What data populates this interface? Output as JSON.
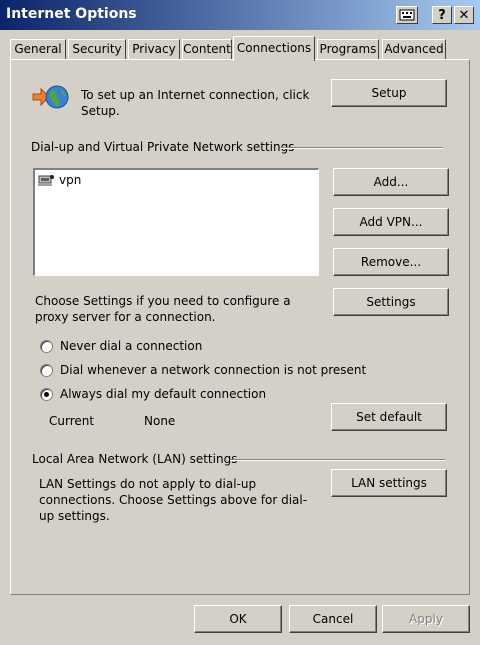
{
  "window": {
    "title": "Internet Options",
    "help_glyph": "?",
    "close_glyph": "✕"
  },
  "tabs": [
    {
      "label": "General"
    },
    {
      "label": "Security"
    },
    {
      "label": "Privacy"
    },
    {
      "label": "Content"
    },
    {
      "label": "Connections"
    },
    {
      "label": "Programs"
    },
    {
      "label": "Advanced"
    }
  ],
  "active_tab": "Connections",
  "setup": {
    "text": "To set up an Internet connection, click Setup.",
    "button": "Setup"
  },
  "dialup": {
    "group_label": "Dial-up and Virtual Private Network settings",
    "connections": [
      {
        "name": "vpn"
      }
    ],
    "add_button": "Add...",
    "add_vpn_button": "Add VPN...",
    "remove_button": "Remove...",
    "proxy_text": "Choose Settings if you need to configure a proxy server for a connection.",
    "settings_button": "Settings",
    "options": [
      {
        "label": "Never dial a connection",
        "selected": false
      },
      {
        "label": "Dial whenever a network connection is not present",
        "selected": false
      },
      {
        "label": "Always dial my default connection",
        "selected": true
      }
    ],
    "current_label": "Current",
    "current_value": "None",
    "set_default_button": "Set default"
  },
  "lan": {
    "group_label": "Local Area Network (LAN) settings",
    "text": "LAN Settings do not apply to dial-up connections. Choose Settings above for dial-up settings.",
    "button": "LAN settings"
  },
  "footer": {
    "ok": "OK",
    "cancel": "Cancel",
    "apply": "Apply",
    "apply_enabled": false
  }
}
